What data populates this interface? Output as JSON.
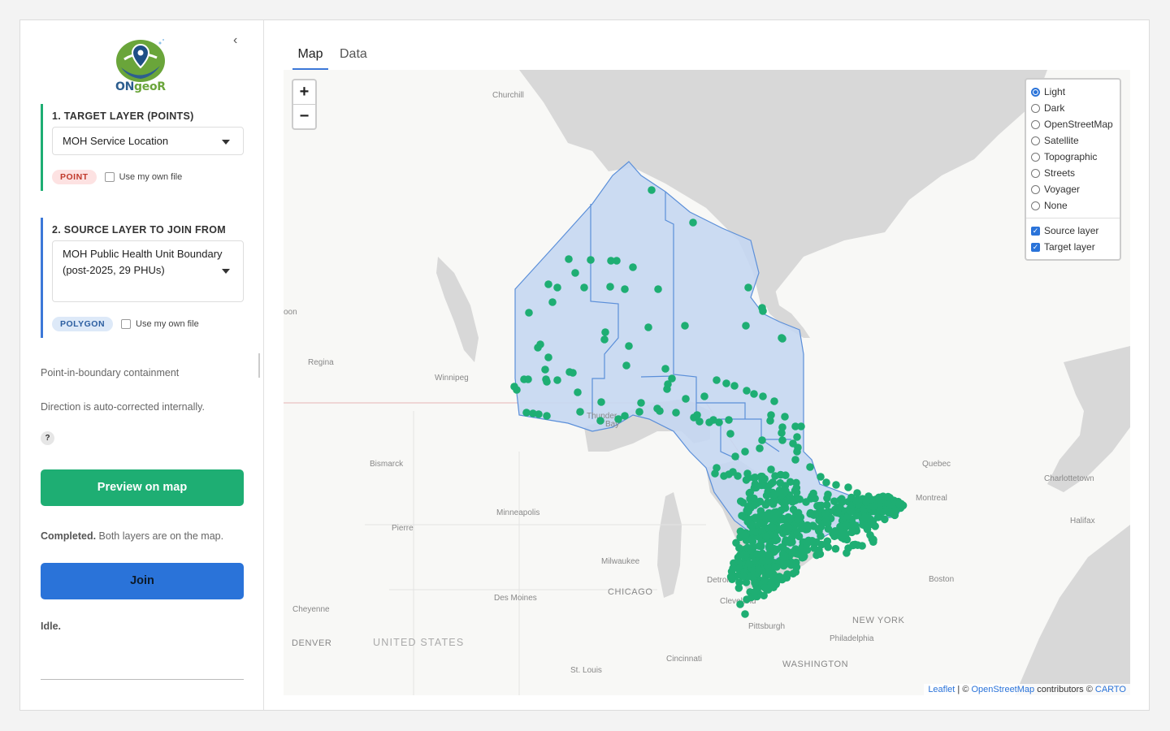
{
  "app": {
    "logo_text_a": "ON",
    "logo_text_b": "geoR",
    "collapse_icon": "chevron-left-icon"
  },
  "target": {
    "title": "1. TARGET LAYER (POINTS)",
    "selected": "MOH Service Location",
    "badge": "POINT",
    "own_file_label": "Use my own file"
  },
  "source": {
    "title": "2. SOURCE LAYER TO JOIN FROM",
    "selected": "MOH Public Health Unit Boundary (post-2025, 29 PHUs)",
    "badge": "POLYGON",
    "own_file_label": "Use my own file"
  },
  "join_type": "Point-in-boundary containment",
  "direction_note": "Direction is auto-corrected internally.",
  "help_label": "?",
  "preview_button": "Preview on map",
  "preview_status_bold": "Completed.",
  "preview_status_rest": " Both layers are on the map.",
  "join_button": "Join",
  "join_status": "Idle.",
  "tabs": [
    {
      "label": "Map",
      "active": true
    },
    {
      "label": "Data",
      "active": false
    }
  ],
  "zoom": {
    "in": "+",
    "out": "−"
  },
  "basemaps": [
    {
      "label": "Light",
      "selected": true
    },
    {
      "label": "Dark",
      "selected": false
    },
    {
      "label": "OpenStreetMap",
      "selected": false
    },
    {
      "label": "Satellite",
      "selected": false
    },
    {
      "label": "Topographic",
      "selected": false
    },
    {
      "label": "Streets",
      "selected": false
    },
    {
      "label": "Voyager",
      "selected": false
    },
    {
      "label": "None",
      "selected": false
    }
  ],
  "overlays": [
    {
      "label": "Source layer",
      "checked": true
    },
    {
      "label": "Target layer",
      "checked": true
    }
  ],
  "attribution": {
    "leaflet": "Leaflet",
    "sep": " | © ",
    "osm": "OpenStreetMap",
    "mid": " contributors © ",
    "carto": "CARTO"
  },
  "cities": {
    "churchill": "Churchill",
    "oon": "oon",
    "regina": "Regina",
    "winnipeg": "Winnipeg",
    "thunder_a": "Thunder",
    "thunder_b": "Bay",
    "bismarck": "Bismarck",
    "minneapolis": "Minneapolis",
    "pierre": "Pierre",
    "milwaukee": "Milwaukee",
    "chicago": "CHICAGO",
    "detroit": "Detroit",
    "cleveland": "Cleveland",
    "des_moines": "Des Moines",
    "cheyenne": "Cheyenne",
    "denver": "DENVER",
    "united_states": "UNITED STATES",
    "pittsburgh": "Pittsburgh",
    "new_york": "NEW YORK",
    "philadelphia": "Philadelphia",
    "washington": "WASHINGTON",
    "cincinnati": "Cincinnati",
    "st_louis": "St. Louis",
    "boston": "Boston",
    "quebec": "Quebec",
    "montreal": "Montreal",
    "charlottetown": "Charlottetown",
    "halifax": "Halifax"
  },
  "colors": {
    "accent_green": "#1eae73",
    "accent_blue": "#2a73d9",
    "polygon_fill": "#c5d7f2",
    "polygon_stroke": "#5b8fd9",
    "point": "#1eae73"
  }
}
